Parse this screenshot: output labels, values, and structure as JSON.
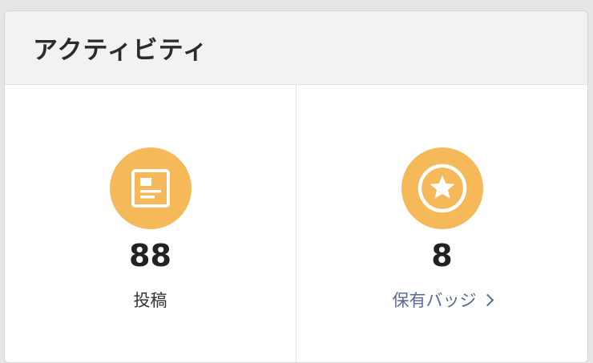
{
  "card": {
    "title": "アクティビティ"
  },
  "stats": [
    {
      "icon": "article-icon",
      "value": "88",
      "label": "投稿",
      "link": false
    },
    {
      "icon": "star-badge-icon",
      "value": "8",
      "label": "保有バッジ",
      "link": true
    }
  ],
  "colors": {
    "icon_bg": "#f5b95a",
    "link": "#5a6a96",
    "header_bg": "#f2f2f2"
  }
}
